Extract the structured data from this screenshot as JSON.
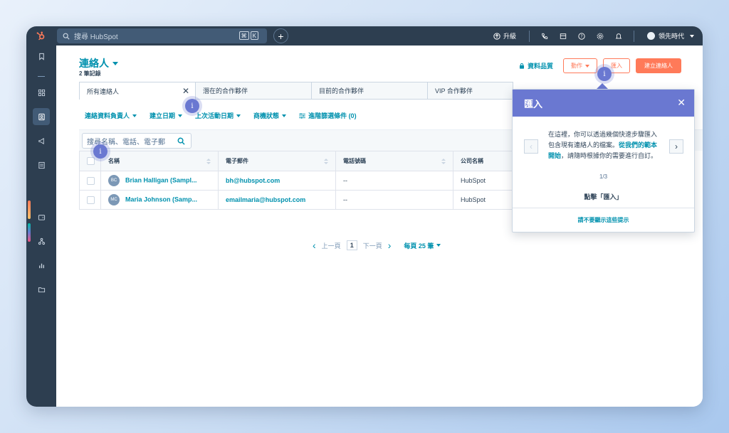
{
  "topbar": {
    "search_placeholder": "搜尋 HubSpot",
    "kbd": [
      "⌘",
      "K"
    ],
    "upgrade_label": "升級",
    "user_name": "領先時代"
  },
  "header": {
    "title": "連絡人",
    "record_count": "2 筆記錄",
    "data_quality": "資料品質",
    "actions_label": "動作",
    "import_label": "匯入",
    "create_label": "建立連絡人"
  },
  "tabs": [
    {
      "label": "所有連絡人"
    },
    {
      "label": "潛在的合作夥伴"
    },
    {
      "label": "目前的合作夥伴"
    },
    {
      "label": "VIP 合作夥伴"
    }
  ],
  "filters": {
    "owner": "連絡資料負責人",
    "created": "建立日期",
    "last_activity": "上次活動日期",
    "lead_status": "商機狀態",
    "advanced": "進階篩選條件 (0)"
  },
  "table": {
    "search_placeholder": "搜尋名稱、電話、電子郵",
    "columns": [
      "名稱",
      "電子郵件",
      "電話號碼",
      "公司名稱"
    ],
    "rows": [
      {
        "initials": "BC",
        "name": "Brian Halligan (Sampl...",
        "email": "bh@hubspot.com",
        "phone": "--",
        "company": "HubSpot"
      },
      {
        "initials": "MC",
        "name": "Maria Johnson (Samp...",
        "email": "emailmaria@hubspot.com",
        "phone": "--",
        "company": "HubSpot"
      }
    ]
  },
  "pager": {
    "prev": "上一頁",
    "current": "1",
    "next": "下一頁",
    "per_page": "每頁 25 筆"
  },
  "popover": {
    "title": "匯入",
    "body_pre": "在這裡，你可以透過幾個快速步驟匯入包含現有連絡人的檔案。",
    "body_link": "從我們的範本開始",
    "body_post": "，請隨時根據你的需要進行自訂。",
    "step": "1/3",
    "cta": "點擊「匯入」",
    "dismiss": "請不要顯示這些提示"
  },
  "beacon_symbol": "i",
  "colors": {
    "nav": "#2d3e50",
    "accent": "#0091ae",
    "orange": "#ff7a59",
    "popover": "#6a78d1"
  }
}
